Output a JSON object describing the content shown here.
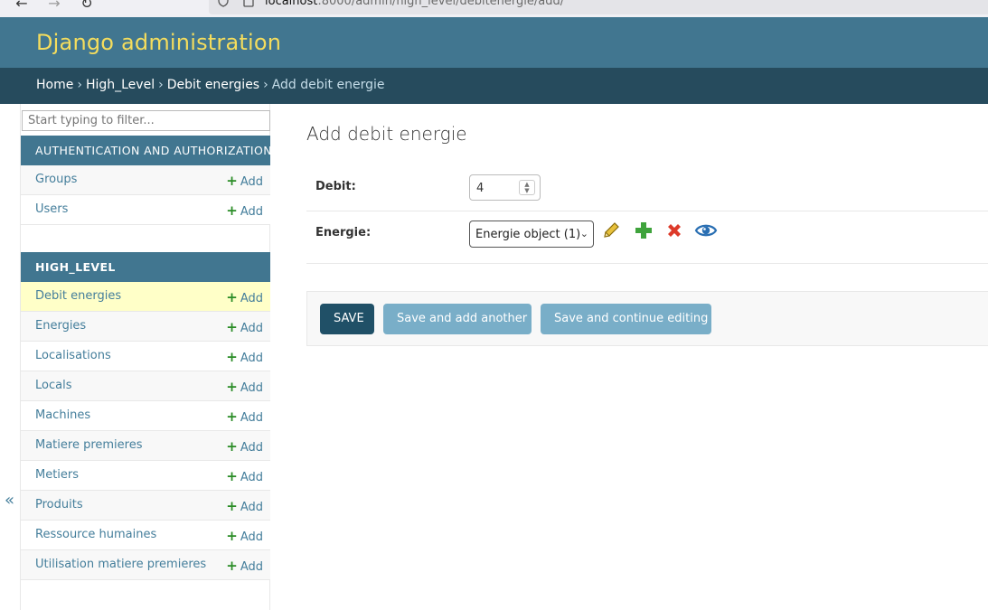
{
  "browser": {
    "back_icon": "←",
    "forward_icon": "→",
    "reload_icon": "↻",
    "url_host": "localhost",
    "url_rest": ":8000/admin/high_level/debitenergie/add/"
  },
  "header": {
    "brand": "Django administration"
  },
  "breadcrumbs": {
    "home": "Home",
    "app": "High_Level",
    "model": "Debit energies",
    "current": "Add debit energie",
    "separator": "›"
  },
  "sidebar": {
    "filter_placeholder": "Start typing to filter...",
    "add_label": "Add",
    "collapse_icon": "«",
    "auth_module": {
      "caption": "AUTHENTICATION AND AUTHORIZATION",
      "items": [
        "Groups",
        "Users"
      ]
    },
    "app_module": {
      "caption": "HIGH_LEVEL",
      "items": [
        "Debit energies",
        "Energies",
        "Localisations",
        "Locals",
        "Machines",
        "Matiere premieres",
        "Metiers",
        "Produits",
        "Ressource humaines",
        "Utilisation matiere premieres"
      ]
    }
  },
  "main": {
    "title": "Add debit energie",
    "fields": {
      "debit_label": "Debit:",
      "debit_value": "4",
      "energie_label": "Energie:",
      "energie_selected": "Energie object (1)"
    },
    "buttons": {
      "save": "SAVE",
      "save_add_another": "Save and add another",
      "save_continue": "Save and continue editing"
    }
  }
}
